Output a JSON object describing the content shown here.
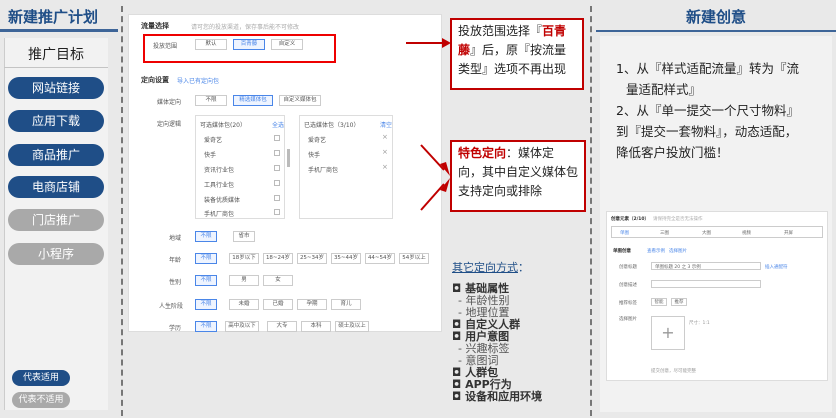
{
  "left": {
    "title": "新建推广计划",
    "goal_heading": "推广目标",
    "items": [
      {
        "label": "网站链接",
        "supported": true
      },
      {
        "label": "应用下载",
        "supported": true
      },
      {
        "label": "商品推广",
        "supported": true
      },
      {
        "label": "电商店铺",
        "supported": true
      },
      {
        "label": "门店推广",
        "supported": false
      },
      {
        "label": "小程序",
        "supported": false
      }
    ],
    "legend_supported": "代表适用",
    "legend_unsupported": "代表不适用"
  },
  "screenshot": {
    "traffic_title": "流量选择",
    "traffic_hint": "请可您的投放渠道，保存事后能不可修改",
    "range_label": "投放范围",
    "range_options": [
      "默认",
      "百青藤",
      "自定义"
    ],
    "targeting_title": "定向设置",
    "targeting_link": "导入已有定向包",
    "media_label": "媒体定向",
    "media_options": [
      "不限",
      "精选媒体包",
      "自定义媒体包"
    ],
    "logic_label": "定向逻辑",
    "available_header": "可选媒体包(20）",
    "available_all": "全选",
    "available_items": [
      "爱奇艺",
      "快手",
      "资讯行业包",
      "工具行业包",
      "装备优质媒体",
      "手机厂商包"
    ],
    "selected_header": "已选媒体包（3/10）",
    "selected_clear": "清空",
    "selected_items": [
      "爱奇艺",
      "快手",
      "手机厂商包"
    ],
    "region_label": "地域",
    "region_options": [
      "不限",
      "省市"
    ],
    "age_label": "年龄",
    "age_options": [
      "不限",
      "18岁以下",
      "18~24岁",
      "25~34岁",
      "35~44岁",
      "44~54岁",
      "54岁以上"
    ],
    "gender_label": "性别",
    "gender_options": [
      "不限",
      "男",
      "女"
    ],
    "life_label": "人生阶段",
    "life_options": [
      "不限",
      "未婚",
      "已婚",
      "孕期",
      "育儿"
    ],
    "edu_label": "学历",
    "edu_options": [
      "不限",
      "高中及以下",
      "大专",
      "本科",
      "硕士及以上"
    ]
  },
  "notes": {
    "note1_prefix": "投放范围选择『",
    "note1_highlight": "百青藤",
    "note1_suffix": "』后，原『按流量类型』选项不再出现",
    "note2_highlight": "特色定向",
    "note2_suffix": "：媒体定向，其中自定义媒体包支持定向或排除"
  },
  "other": {
    "title": "其它定向方式",
    "colon": "：",
    "items": [
      {
        "text": "基础属性",
        "type": "head"
      },
      {
        "text": "年龄性别",
        "type": "sub"
      },
      {
        "text": "地理位置",
        "type": "sub"
      },
      {
        "text": "自定义人群",
        "type": "head"
      },
      {
        "text": "用户意图",
        "type": "head"
      },
      {
        "text": "兴趣标签",
        "type": "sub"
      },
      {
        "text": "意图词",
        "type": "sub"
      },
      {
        "text": "人群包",
        "type": "head"
      },
      {
        "text": "APP行为",
        "type": "head"
      },
      {
        "text": "设备和应用环境",
        "type": "head"
      }
    ]
  },
  "right": {
    "title": "新建创意",
    "line1a": "1、从『样式适配流量』转为『流",
    "line1b": "量适配样式』",
    "line2a": "2、从『单一提交一个尺寸物料』",
    "line2b": "到『提交一套物料』，动态适配，",
    "line2c": "降低客户投放门槛！"
  },
  "mini": {
    "heading": "创意元素（2/10）",
    "heading_hint": "请保持完全是否无法操作",
    "tabs": [
      "单图",
      "三图",
      "大图",
      "视频",
      "开屏"
    ],
    "group_title": "单图创意",
    "group_links": [
      "查看示例",
      "选择图片"
    ],
    "field_title": "创意标题",
    "field_title_value": "单图标题 20 之 3 示例",
    "field_title_link": "插入通配符",
    "field_desc": "创意描述",
    "field_tags": "推荐标签",
    "tag_buttons": [
      "智能",
      "推荐"
    ],
    "field_image": "选择图片",
    "image_hint": "尺寸：1:1",
    "footer_note": "提交创意，尽可能完整"
  },
  "colors": {
    "brand": "#1f4e87",
    "inactive": "#a9a9a9",
    "alert": "#c00000",
    "link": "#4a86e8"
  }
}
